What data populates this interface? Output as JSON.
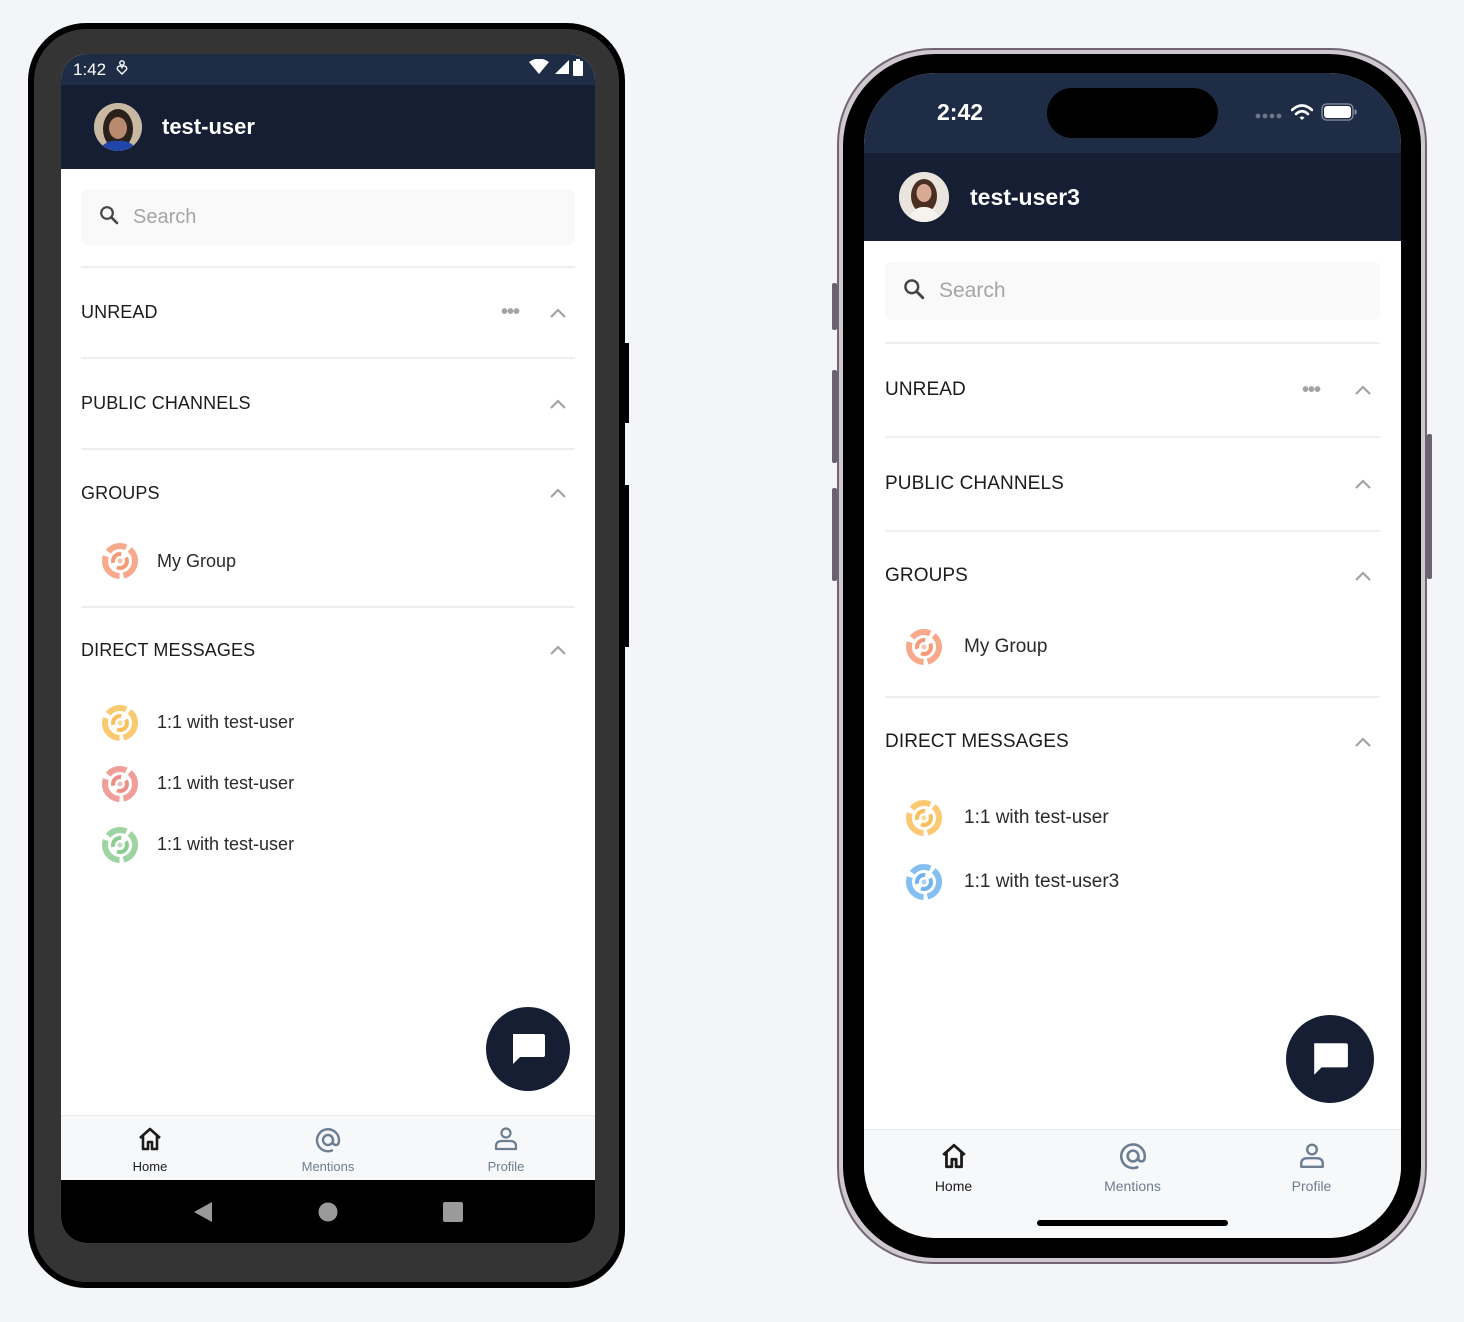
{
  "devices": {
    "android": {
      "statusbar": {
        "time": "1:42",
        "notification_icon": "accessibility-icon",
        "icons": [
          "wifi-icon",
          "signal-icon",
          "battery-icon"
        ]
      },
      "header": {
        "username": "test-user",
        "avatar": "user-avatar-photo"
      },
      "search": {
        "placeholder": "Search",
        "value": ""
      },
      "sections": [
        {
          "title": "UNREAD",
          "has_more": true,
          "expanded": true,
          "items": []
        },
        {
          "title": "PUBLIC CHANNELS",
          "has_more": false,
          "expanded": true,
          "items": []
        },
        {
          "title": "GROUPS",
          "has_more": false,
          "expanded": true,
          "items": [
            {
              "label": "My Group",
              "icon_color": "#f79a77"
            }
          ]
        },
        {
          "title": "DIRECT MESSAGES",
          "has_more": false,
          "expanded": true,
          "items": [
            {
              "label": "1:1 with test-user",
              "icon_color": "#fbbf5a"
            },
            {
              "label": "1:1 with test-user",
              "icon_color": "#ec8e86"
            },
            {
              "label": "1:1 with test-user",
              "icon_color": "#8ccd92"
            }
          ]
        }
      ],
      "fab_icon": "chat-bubble-icon",
      "tabs": [
        {
          "label": "Home",
          "icon": "home-icon",
          "active": true
        },
        {
          "label": "Mentions",
          "icon": "at-icon",
          "active": false
        },
        {
          "label": "Profile",
          "icon": "user-icon",
          "active": false
        }
      ],
      "navbar": [
        "back-icon",
        "home-circle-icon",
        "recents-icon"
      ]
    },
    "iphone": {
      "statusbar": {
        "time": "2:42",
        "icons": [
          "signal-dots-icon",
          "wifi-icon",
          "battery-icon"
        ]
      },
      "header": {
        "username": "test-user3",
        "avatar": "user-avatar-photo"
      },
      "search": {
        "placeholder": "Search",
        "value": ""
      },
      "sections": [
        {
          "title": "UNREAD",
          "has_more": true,
          "expanded": true,
          "items": []
        },
        {
          "title": "PUBLIC CHANNELS",
          "has_more": false,
          "expanded": true,
          "items": []
        },
        {
          "title": "GROUPS",
          "has_more": false,
          "expanded": true,
          "items": [
            {
              "label": "My Group",
              "icon_color": "#f79a77"
            }
          ]
        },
        {
          "title": "DIRECT MESSAGES",
          "has_more": false,
          "expanded": true,
          "items": [
            {
              "label": "1:1 with test-user",
              "icon_color": "#fbbf5a"
            },
            {
              "label": "1:1 with test-user3",
              "icon_color": "#6fb4f0"
            }
          ]
        }
      ],
      "fab_icon": "chat-bubble-icon",
      "tabs": [
        {
          "label": "Home",
          "icon": "home-icon",
          "active": true
        },
        {
          "label": "Mentions",
          "icon": "at-icon",
          "active": false
        },
        {
          "label": "Profile",
          "icon": "user-icon",
          "active": false
        }
      ]
    }
  },
  "colors": {
    "header_bg": "#161e33",
    "statusbar_bg": "#1f2c46",
    "fab_bg": "#161e33",
    "tab_inactive": "#6e7e92",
    "page_bg": "#f4f5f9"
  }
}
